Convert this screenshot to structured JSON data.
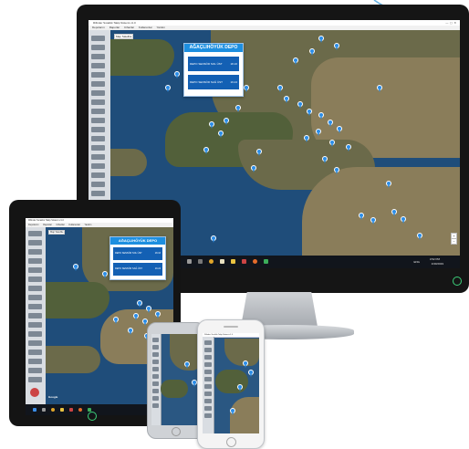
{
  "app": {
    "window_title": "Rifinder Sıcaklık Takip Sistemi v1.0",
    "menu_items": [
      "Depolarım",
      "Raporlar",
      "Cihazlar",
      "Kullanıcılar",
      "Yardım"
    ],
    "map_type": {
      "map": "Map",
      "satellite": "Satellite"
    },
    "zoom_in": "+",
    "zoom_out": "−",
    "map_brand": "Google"
  },
  "popup": {
    "title": "AĞAÇLIHÖYÜK DEPO",
    "rows": [
      {
        "key": "DEPO SENSÖR SOL ÜST",
        "value": "18.16"
      },
      {
        "key": "DEPO SENSÖR SAĞ ÜST",
        "value": "19.24"
      }
    ]
  },
  "taskbar": {
    "tray_lang": "ENG",
    "time": "3:52 PM",
    "date": "1/30/2019"
  },
  "colors": {
    "bezel": "#151515",
    "water": "#1f4d7a",
    "marker": "#2a8de8",
    "popup_header": "#1d8fe0",
    "popup_row": "#1360b4",
    "power_led": "#3cd07a"
  },
  "icons": [
    "power-icon",
    "map-marker-icon",
    "home-button-icon"
  ]
}
